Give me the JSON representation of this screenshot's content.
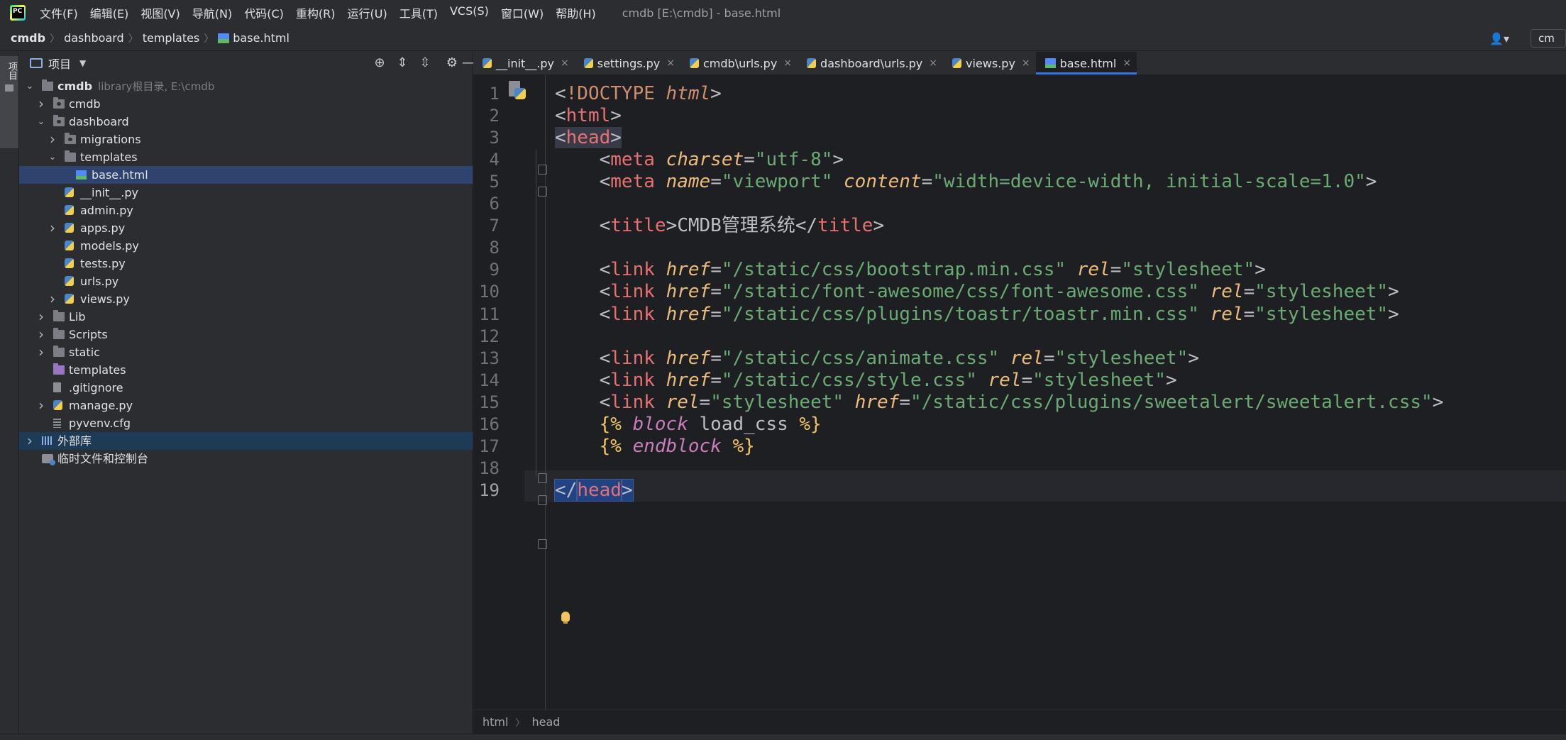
{
  "menubar": {
    "items": [
      "文件(F)",
      "编辑(E)",
      "视图(V)",
      "导航(N)",
      "代码(C)",
      "重构(R)",
      "运行(U)",
      "工具(T)",
      "VCS(S)",
      "窗口(W)",
      "帮助(H)"
    ],
    "window_title": "cmdb [E:\\cmdb] - base.html"
  },
  "navbar": {
    "breadcrumb": [
      "cmdb",
      "dashboard",
      "templates",
      "base.html"
    ],
    "user_button": "👤▾",
    "run_config": "cm"
  },
  "tool_strip": {
    "project_label": "项目"
  },
  "project_panel": {
    "title": "项目",
    "tree": [
      {
        "label": "cmdb",
        "hint": "library根目录, E:\\cmdb",
        "icon": "folder-icon",
        "depth": 0,
        "expanded": true
      },
      {
        "label": "cmdb",
        "icon": "package-folder-icon",
        "depth": 1,
        "expanded": false
      },
      {
        "label": "dashboard",
        "icon": "package-folder-icon",
        "depth": 1,
        "expanded": true
      },
      {
        "label": "migrations",
        "icon": "package-folder-icon",
        "depth": 2,
        "expanded": false
      },
      {
        "label": "templates",
        "icon": "folder-icon",
        "depth": 2,
        "expanded": true
      },
      {
        "label": "base.html",
        "icon": "html-file-icon",
        "depth": 3,
        "selected": true
      },
      {
        "label": "__init__.py",
        "icon": "python-file-icon",
        "depth": 2
      },
      {
        "label": "admin.py",
        "icon": "python-file-icon",
        "depth": 2
      },
      {
        "label": "apps.py",
        "icon": "python-file-icon",
        "depth": 2,
        "expanded": false
      },
      {
        "label": "models.py",
        "icon": "python-file-icon",
        "depth": 2
      },
      {
        "label": "tests.py",
        "icon": "python-file-icon",
        "depth": 2
      },
      {
        "label": "urls.py",
        "icon": "python-file-icon",
        "depth": 2
      },
      {
        "label": "views.py",
        "icon": "python-file-icon",
        "depth": 2,
        "expanded": false
      },
      {
        "label": "Lib",
        "icon": "folder-icon",
        "depth": 1,
        "expanded": false
      },
      {
        "label": "Scripts",
        "icon": "folder-icon",
        "depth": 1,
        "expanded": false
      },
      {
        "label": "static",
        "icon": "folder-icon",
        "depth": 1,
        "expanded": false
      },
      {
        "label": "templates",
        "icon": "template-folder-icon",
        "depth": 1
      },
      {
        "label": ".gitignore",
        "icon": "gitignore-file-icon",
        "depth": 1
      },
      {
        "label": "manage.py",
        "icon": "python-file-icon",
        "depth": 1,
        "expanded": false
      },
      {
        "label": "pyvenv.cfg",
        "icon": "config-file-icon",
        "depth": 1
      },
      {
        "label": "外部库",
        "icon": "library-icon",
        "depth": 0,
        "expanded": false,
        "highlighted": true
      },
      {
        "label": "临时文件和控制台",
        "icon": "scratches-icon",
        "depth": 0
      }
    ]
  },
  "editor": {
    "tabs": [
      {
        "label": "__init__.py",
        "icon": "python-file-icon"
      },
      {
        "label": "settings.py",
        "icon": "python-file-icon"
      },
      {
        "label": "cmdb\\urls.py",
        "icon": "python-file-icon"
      },
      {
        "label": "dashboard\\urls.py",
        "icon": "python-file-icon"
      },
      {
        "label": "views.py",
        "icon": "python-file-icon"
      },
      {
        "label": "base.html",
        "icon": "html-file-icon",
        "active": true
      }
    ],
    "current_line": 19,
    "lines": [
      [
        [
          "t-bracket",
          "<"
        ],
        [
          "t-html",
          "!DOCTYPE "
        ],
        [
          "t-doctype",
          "html"
        ],
        [
          "t-bracket",
          ">"
        ]
      ],
      [
        [
          "t-bracket",
          "<"
        ],
        [
          "t-tagname",
          "html"
        ],
        [
          "t-bracket",
          ">"
        ]
      ],
      [
        [
          "t-bracket hl-head",
          "<"
        ],
        [
          "t-tagname hl-head",
          "head"
        ],
        [
          "t-bracket hl-head",
          ">"
        ]
      ],
      [
        [
          "",
          "    "
        ],
        [
          "t-bracket",
          "<"
        ],
        [
          "t-tagname",
          "meta "
        ],
        [
          "t-attr",
          "charset"
        ],
        [
          "t-bracket",
          "="
        ],
        [
          "t-str",
          "\"utf-8\""
        ],
        [
          "t-bracket",
          ">"
        ]
      ],
      [
        [
          "",
          "    "
        ],
        [
          "t-bracket",
          "<"
        ],
        [
          "t-tagname",
          "meta "
        ],
        [
          "t-attr",
          "name"
        ],
        [
          "t-bracket",
          "="
        ],
        [
          "t-str",
          "\"viewport\" "
        ],
        [
          "t-attr",
          "content"
        ],
        [
          "t-bracket",
          "="
        ],
        [
          "t-str",
          "\"width=device-width, initial-scale=1.0\""
        ],
        [
          "t-bracket",
          ">"
        ]
      ],
      [
        [
          "",
          ""
        ]
      ],
      [
        [
          "",
          "    "
        ],
        [
          "t-bracket",
          "<"
        ],
        [
          "t-tagname",
          "title"
        ],
        [
          "t-bracket",
          ">"
        ],
        [
          "",
          "CMDB管理系统"
        ],
        [
          "t-bracket",
          "</"
        ],
        [
          "t-tagname",
          "title"
        ],
        [
          "t-bracket",
          ">"
        ]
      ],
      [
        [
          "",
          ""
        ]
      ],
      [
        [
          "",
          "    "
        ],
        [
          "t-bracket",
          "<"
        ],
        [
          "t-tagname",
          "link "
        ],
        [
          "t-attr",
          "href"
        ],
        [
          "t-bracket",
          "="
        ],
        [
          "t-str",
          "\"/static/css/bootstrap.min.css\" "
        ],
        [
          "t-attr",
          "rel"
        ],
        [
          "t-bracket",
          "="
        ],
        [
          "t-str",
          "\"stylesheet\""
        ],
        [
          "t-bracket",
          ">"
        ]
      ],
      [
        [
          "",
          "    "
        ],
        [
          "t-bracket",
          "<"
        ],
        [
          "t-tagname",
          "link "
        ],
        [
          "t-attr",
          "href"
        ],
        [
          "t-bracket",
          "="
        ],
        [
          "t-str",
          "\"/static/font-awesome/css/font-awesome.css\" "
        ],
        [
          "t-attr",
          "rel"
        ],
        [
          "t-bracket",
          "="
        ],
        [
          "t-str",
          "\"stylesheet\""
        ],
        [
          "t-bracket",
          ">"
        ]
      ],
      [
        [
          "",
          "    "
        ],
        [
          "t-bracket",
          "<"
        ],
        [
          "t-tagname",
          "link "
        ],
        [
          "t-attr",
          "href"
        ],
        [
          "t-bracket",
          "="
        ],
        [
          "t-str",
          "\"/static/css/plugins/toastr/toastr.min.css\" "
        ],
        [
          "t-attr",
          "rel"
        ],
        [
          "t-bracket",
          "="
        ],
        [
          "t-str",
          "\"stylesheet\""
        ],
        [
          "t-bracket",
          ">"
        ]
      ],
      [
        [
          "",
          ""
        ]
      ],
      [
        [
          "",
          "    "
        ],
        [
          "t-bracket",
          "<"
        ],
        [
          "t-tagname",
          "link "
        ],
        [
          "t-attr",
          "href"
        ],
        [
          "t-bracket",
          "="
        ],
        [
          "t-str",
          "\"/static/css/animate.css\" "
        ],
        [
          "t-attr",
          "rel"
        ],
        [
          "t-bracket",
          "="
        ],
        [
          "t-str",
          "\"stylesheet\""
        ],
        [
          "t-bracket",
          ">"
        ]
      ],
      [
        [
          "",
          "    "
        ],
        [
          "t-bracket",
          "<"
        ],
        [
          "t-tagname",
          "link "
        ],
        [
          "t-attr",
          "href"
        ],
        [
          "t-bracket",
          "="
        ],
        [
          "t-str",
          "\"/static/css/style.css\" "
        ],
        [
          "t-attr",
          "rel"
        ],
        [
          "t-bracket",
          "="
        ],
        [
          "t-str",
          "\"stylesheet\""
        ],
        [
          "t-bracket",
          ">"
        ]
      ],
      [
        [
          "",
          "    "
        ],
        [
          "t-bracket",
          "<"
        ],
        [
          "t-tagname",
          "link "
        ],
        [
          "t-attr",
          "rel"
        ],
        [
          "t-bracket",
          "="
        ],
        [
          "t-str",
          "\"stylesheet\" "
        ],
        [
          "t-attr",
          "href"
        ],
        [
          "t-bracket",
          "="
        ],
        [
          "t-str",
          "\"/static/css/plugins/sweetalert/sweetalert.css\""
        ],
        [
          "t-bracket",
          ">"
        ]
      ],
      [
        [
          "",
          "    "
        ],
        [
          "t-tpl",
          "{% "
        ],
        [
          "t-kw",
          "block "
        ],
        [
          "",
          "load_css "
        ],
        [
          "t-tpl",
          "%}"
        ]
      ],
      [
        [
          "",
          "    "
        ],
        [
          "t-tpl",
          "{% "
        ],
        [
          "t-kw",
          "endblock "
        ],
        [
          "t-tpl",
          "%}"
        ]
      ],
      [
        [
          "",
          ""
        ]
      ],
      [
        [
          "t-bracket hl-sel",
          "</"
        ],
        [
          "t-tagname hl-sel",
          "head"
        ],
        [
          "t-bracket hl-sel",
          ">"
        ]
      ]
    ],
    "breadcrumbs": [
      "html",
      "head"
    ]
  }
}
